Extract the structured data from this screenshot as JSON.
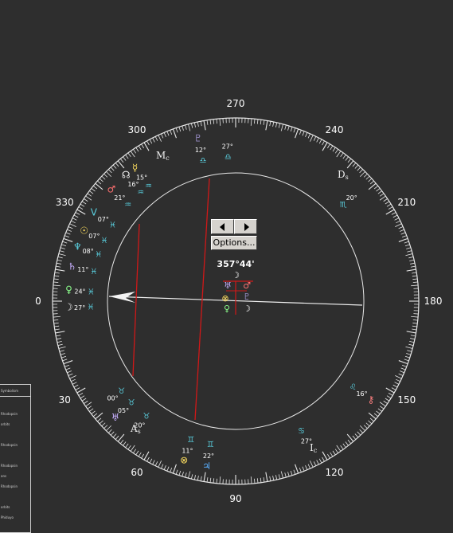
{
  "chart": {
    "outer_labels": [
      "0",
      "30",
      "60",
      "90",
      "120",
      "150",
      "180",
      "210",
      "240",
      "270",
      "300",
      "330"
    ],
    "center_position_label": "357°44'",
    "angles": {
      "asc_symbol": "A",
      "asc_sub": "s",
      "ds_symbol": "D",
      "ds_sub": "s",
      "mc_symbol": "M",
      "mc_sub": "c",
      "ic_symbol": "I",
      "ic_sub": "c"
    },
    "planets": [
      {
        "name": "pluto",
        "glyph": "♇",
        "degree": "12°",
        "sign": "♎",
        "color": "#9b8fc8"
      },
      {
        "name": "mc-sign",
        "glyph": "",
        "degree": "27°",
        "sign": "♎",
        "color": "#ffe060"
      },
      {
        "name": "mercury",
        "glyph": "☿",
        "degree": "15°",
        "sign": "♒",
        "color": "#ffe060"
      },
      {
        "name": "node",
        "glyph": "☊",
        "degree": "16°",
        "sign": "♒",
        "color": "#f0f0f0"
      },
      {
        "name": "mars",
        "glyph": "♂",
        "degree": "21°",
        "sign": "♒",
        "color": "#ff7070"
      },
      {
        "name": "vertex",
        "glyph": "V",
        "degree": "07°",
        "sign": "♓",
        "color": "#5ad0e0"
      },
      {
        "name": "sun",
        "glyph": "☉",
        "degree": "07°",
        "sign": "♓",
        "color": "#ffe060"
      },
      {
        "name": "neptune",
        "glyph": "♆",
        "degree": "08°",
        "sign": "♓",
        "color": "#5ad0e0"
      },
      {
        "name": "saturn",
        "glyph": "♄",
        "degree": "11°",
        "sign": "♓",
        "color": "#c8b0ff"
      },
      {
        "name": "venus",
        "glyph": "♀",
        "degree": "24°",
        "sign": "♓",
        "color": "#8cff8c"
      },
      {
        "name": "moon",
        "glyph": "☽",
        "degree": "27°",
        "sign": "♓",
        "color": "#f0f0f0"
      },
      {
        "name": "ds-sign",
        "glyph": "",
        "degree": "20°",
        "sign": "♏",
        "color": "#5ad0e0"
      },
      {
        "name": "lilith",
        "glyph": "",
        "degree": "00°",
        "sign": "♉",
        "color": "#ffe060"
      },
      {
        "name": "uranus",
        "glyph": "♅",
        "degree": "05°",
        "sign": "♉",
        "color": "#c8b0ff"
      },
      {
        "name": "asc-sign",
        "glyph": "",
        "degree": "20°",
        "sign": "♉",
        "color": "#ffe060"
      },
      {
        "name": "part-of-fortune",
        "glyph": "⊗",
        "degree": "11°",
        "sign": "♊",
        "color": "#ffe060"
      },
      {
        "name": "jupiter",
        "glyph": "♃",
        "degree": "22°",
        "sign": "♊",
        "color": "#5ab0ff"
      },
      {
        "name": "chiron",
        "glyph": "⚷",
        "degree": "16°",
        "sign": "♌",
        "color": "#ff8080"
      },
      {
        "name": "ic-sign",
        "glyph": "",
        "degree": "27°",
        "sign": "♋",
        "color": "#5ad0e0"
      }
    ],
    "center_cluster": [
      "♅",
      "♂",
      "⊗",
      "♇",
      "♀",
      "☽"
    ]
  },
  "controls": {
    "prev_label": "◄",
    "next_label": "►",
    "options_label": "Options..."
  },
  "side_panel": {
    "header": "Symbolism",
    "lines": [
      "Rhodopsin",
      "orbits",
      "",
      "Rhodopsin",
      "",
      "Rhodopsin",
      "ans",
      "Rhodopsin",
      "",
      "orbits",
      "Phiduyo"
    ]
  },
  "colors": {
    "background": "#2e2e2e",
    "wheel": "#e8e8e8",
    "hand": "#d01818",
    "button_face": "#d6d3ce"
  }
}
